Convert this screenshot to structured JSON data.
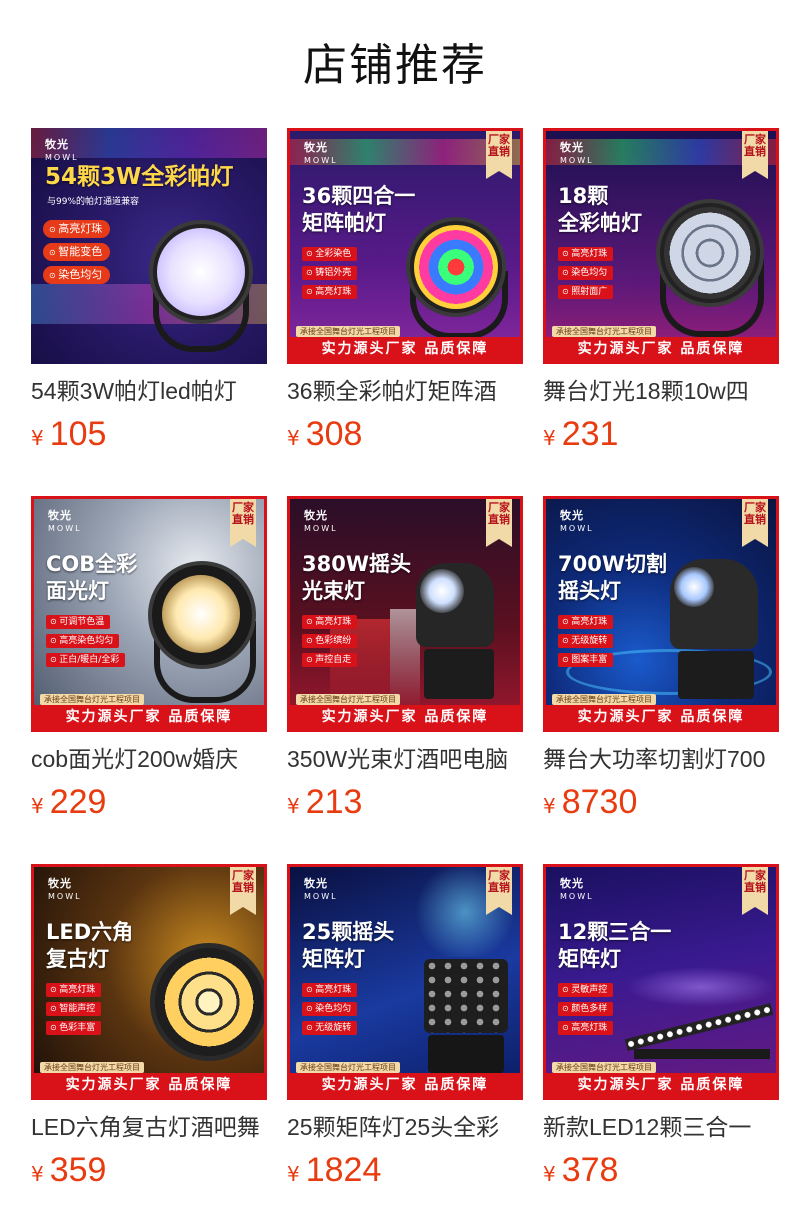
{
  "page": {
    "title": "店铺推荐"
  },
  "common": {
    "currency_symbol": "¥",
    "brand_cn": "牧光",
    "brand_en": "MOWL",
    "ribbon_text": "厂家直销",
    "banner_text": "实力源头厂家 品质保障",
    "note_text": "承接全国舞台灯光工程项目"
  },
  "products": [
    {
      "title": "54颗3W帕灯led帕灯",
      "price": "105",
      "image": {
        "headline": "54颗3W全彩帕灯",
        "subline": "与99%的帕灯通道兼容",
        "features": [
          "高亮灯珠",
          "智能变色",
          "染色均匀"
        ]
      }
    },
    {
      "title": "36颗全彩帕灯矩阵酒",
      "price": "308",
      "image": {
        "headline_lines": [
          "36颗四合一",
          "矩阵帕灯"
        ],
        "features": [
          "全彩染色",
          "铸铝外壳",
          "高亮灯珠"
        ]
      }
    },
    {
      "title": "舞台灯光18颗10w四",
      "price": "231",
      "image": {
        "headline_lines": [
          "18颗",
          "全彩帕灯"
        ],
        "features": [
          "高亮灯珠",
          "染色均匀",
          "照射面广"
        ]
      }
    },
    {
      "title": "cob面光灯200w婚庆",
      "price": "229",
      "image": {
        "headline_lines": [
          "COB全彩",
          "面光灯"
        ],
        "features": [
          "可调节色温",
          "高亮染色均匀",
          "正白/暖白/全彩"
        ]
      }
    },
    {
      "title": "350W光束灯酒吧电脑",
      "price": "213",
      "image": {
        "headline_lines": [
          "380W摇头",
          "光束灯"
        ],
        "features": [
          "高亮灯珠",
          "色彩缤纷",
          "声控自走"
        ]
      }
    },
    {
      "title": "舞台大功率切割灯700",
      "price": "8730",
      "image": {
        "headline_lines": [
          "700W切割",
          "摇头灯"
        ],
        "features": [
          "高亮灯珠",
          "无级旋转",
          "图案丰富"
        ]
      }
    },
    {
      "title": "LED六角复古灯酒吧舞",
      "price": "359",
      "image": {
        "headline_lines": [
          "LED六角",
          "复古灯"
        ],
        "features": [
          "高亮灯珠",
          "智能声控",
          "色彩丰富"
        ]
      }
    },
    {
      "title": "25颗矩阵灯25头全彩",
      "price": "1824",
      "image": {
        "headline_lines": [
          "25颗摇头",
          "矩阵灯"
        ],
        "features": [
          "高亮灯珠",
          "染色均匀",
          "无级旋转"
        ]
      }
    },
    {
      "title": "新款LED12颗三合一",
      "price": "378",
      "image": {
        "headline_lines": [
          "12颗三合一",
          "矩阵灯"
        ],
        "features": [
          "灵敏声控",
          "颜色多样",
          "高亮灯珠"
        ]
      }
    }
  ],
  "colors": {
    "price": "#e83b10",
    "banner": "#d9121a",
    "ribbon": "#f2d9a8"
  }
}
